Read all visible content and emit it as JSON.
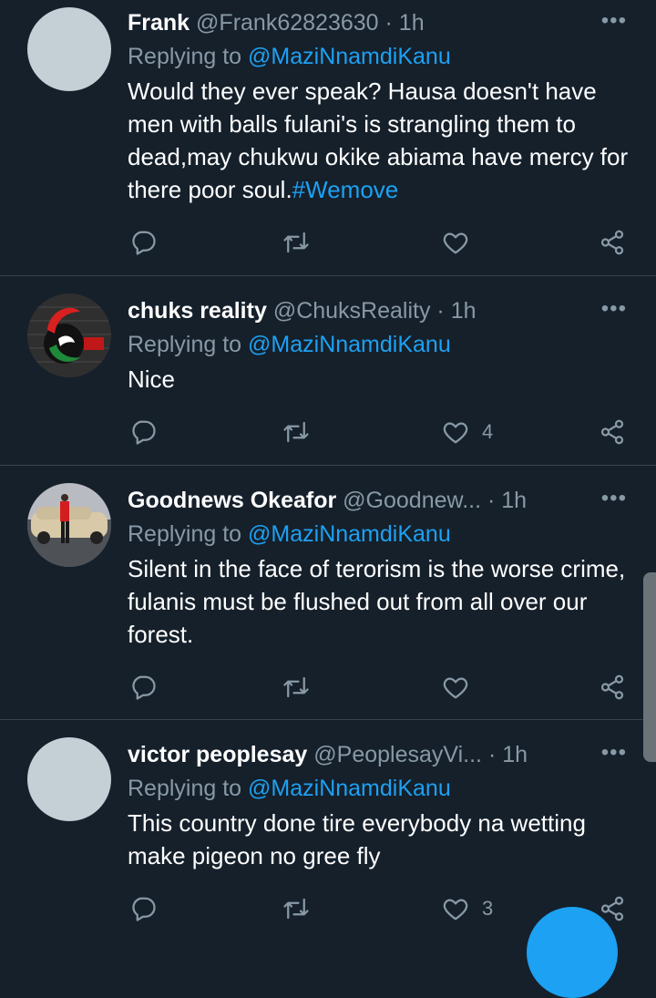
{
  "colors": {
    "background": "#15202b",
    "accent": "#1da1f2",
    "muted": "#8899a6",
    "separator": "#38444d"
  },
  "tweets": [
    {
      "name": "Frank",
      "handle": "@Frank62823630",
      "dot": "·",
      "time": "1h",
      "replying_prefix": "Replying to ",
      "replying_to": "@MaziNnamdiKanu",
      "text": "Would they ever speak? Hausa doesn't have men with balls fulani's is strangling them to dead,may chukwu okike abiama have mercy for there poor soul.",
      "hashtag": "#Wemove",
      "likes": "",
      "avatar": "default-avatar"
    },
    {
      "name": "chuks reality",
      "handle": "@ChuksReality",
      "dot": "·",
      "time": "1h",
      "replying_prefix": "Replying to ",
      "replying_to": "@MaziNnamdiKanu",
      "text": "Nice",
      "likes": "4",
      "avatar": "flag-logo-avatar"
    },
    {
      "name": "Goodnews Okeafor",
      "handle": "@Goodnew...",
      "dot": "·",
      "time": "1h",
      "replying_prefix": "Replying to ",
      "replying_to": "@MaziNnamdiKanu",
      "text": "Silent in the face of terorism is the worse crime, fulanis must be flushed out from all over our forest.",
      "likes": "",
      "avatar": "photo-avatar"
    },
    {
      "name": "victor peoplesay",
      "handle": "@PeoplesayVi...",
      "dot": "·",
      "time": "1h",
      "replying_prefix": "Replying to ",
      "replying_to": "@MaziNnamdiKanu",
      "text": "This country done tire everybody na wetting make pigeon no gree fly",
      "likes": "3",
      "avatar": "default-avatar"
    }
  ],
  "more_glyph": "•••"
}
